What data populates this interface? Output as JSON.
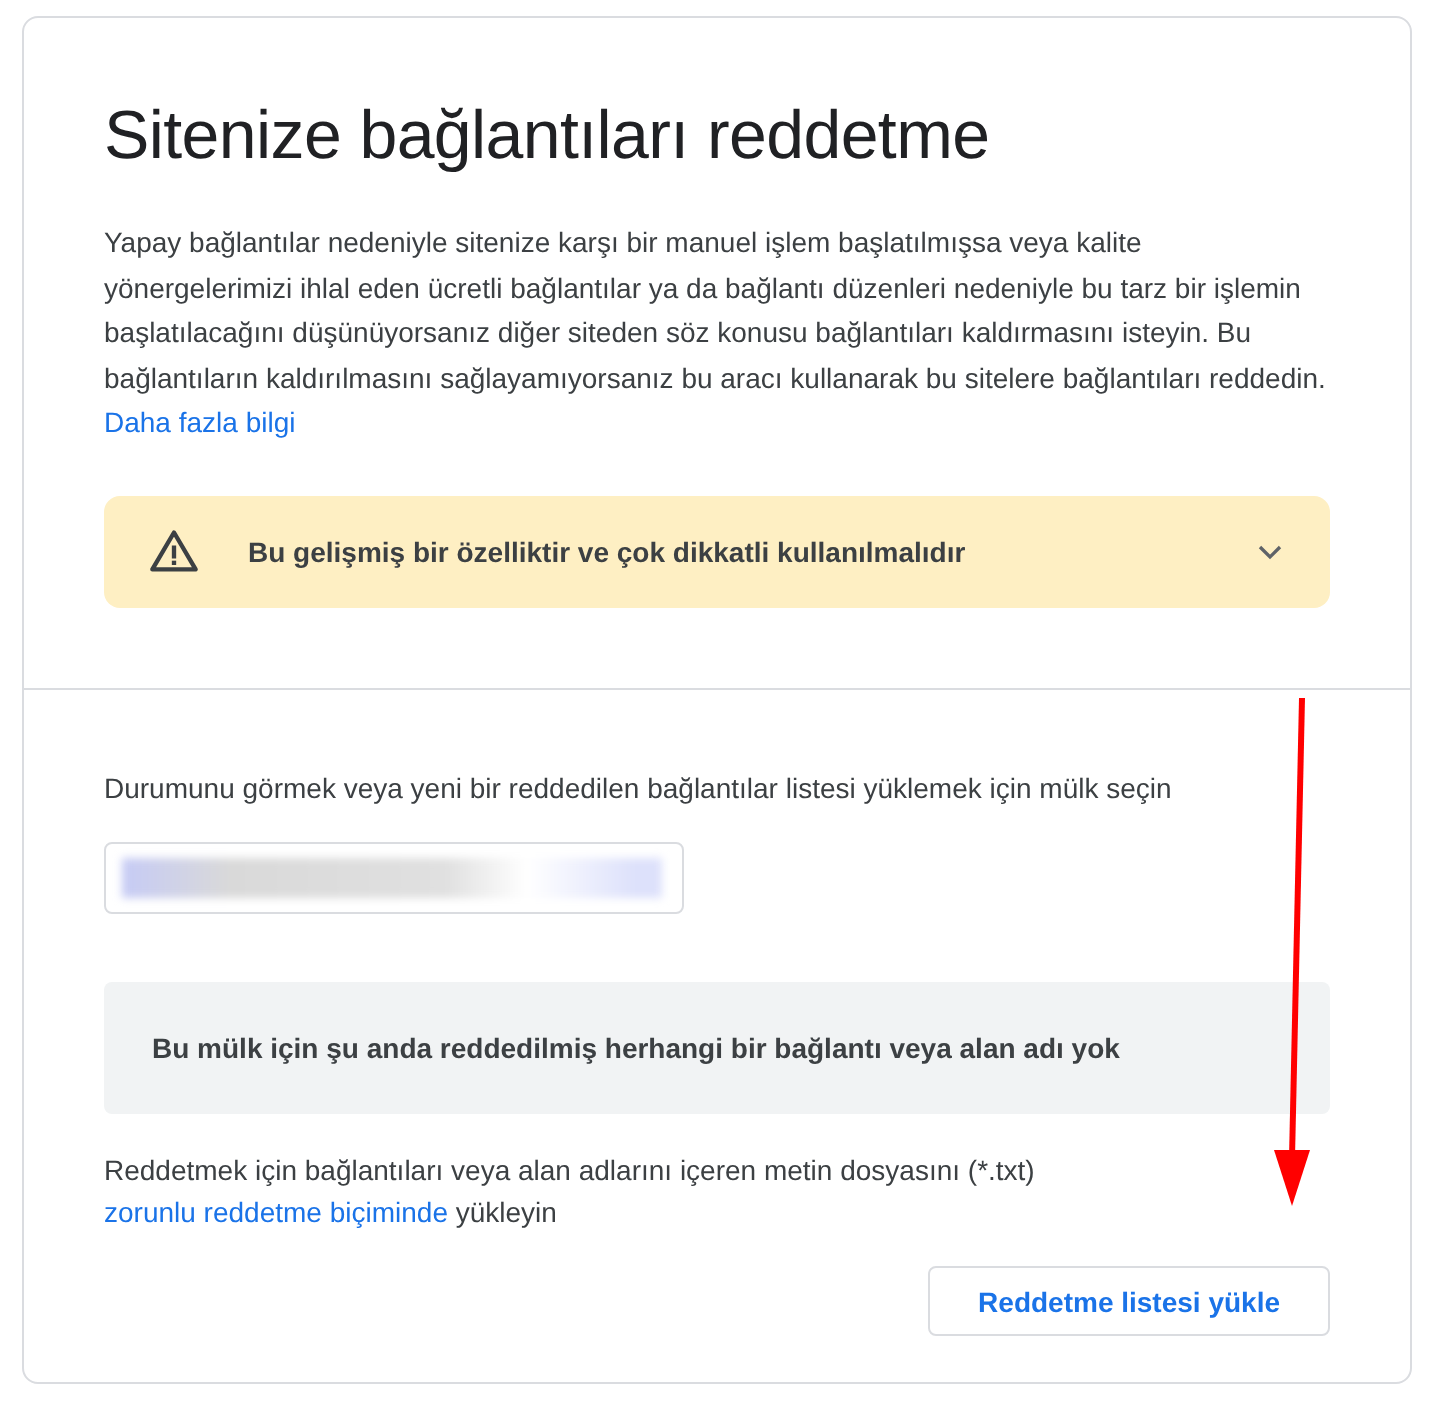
{
  "title": "Sitenize bağlantıları reddetme",
  "intro": {
    "text": "Yapay bağlantılar nedeniyle sitenize karşı bir manuel işlem başlatılmışsa veya kalite yönergelerimizi ihlal eden ücretli bağlantılar ya da bağlantı düzenleri nedeniyle bu tarz bir işlemin başlatılacağını düşünüyorsanız diğer siteden söz konusu bağlantıları kaldırmasını isteyin. Bu bağlantıların kaldırılmasını sağlayamıyorsanız bu aracı kullanarak bu sitelere bağlantıları reddedin.",
    "link": "Daha fazla bilgi"
  },
  "warning": {
    "text": "Bu gelişmiş bir özelliktir ve çok dikkatli kullanılmalıdır",
    "expanded": false
  },
  "property_prompt": "Durumunu görmek veya yeni bir reddedilen bağlantılar listesi yüklemek için mülk seçin",
  "status_message": "Bu mülk için şu anda reddedilmiş herhangi bir bağlantı veya alan adı yok",
  "upload_hint": {
    "text": "Reddetmek için bağlantıları veya alan adlarını içeren metin dosyasını (*.txt)",
    "link": "zorunlu reddetme biçiminde",
    "after": "yükleyin"
  },
  "upload_button": "Reddetme listesi yükle"
}
